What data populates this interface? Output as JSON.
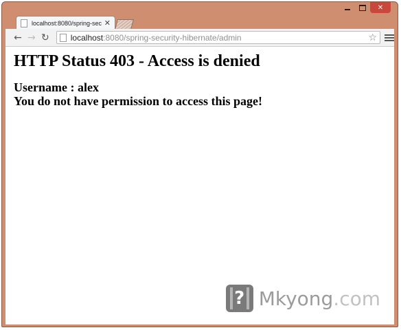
{
  "browser": {
    "tab": {
      "title": "localhost:8080/spring-sec",
      "close_glyph": "✕"
    },
    "address": {
      "host": "localhost",
      "rest": ":8080/spring-security-hibernate/admin"
    },
    "icons": {
      "back": "back-arrow-icon",
      "forward": "forward-arrow-icon",
      "reload": "reload-icon",
      "bookmark": "star-icon",
      "menu": "hamburger-menu-icon"
    }
  },
  "page": {
    "heading": "HTTP Status 403 - Access is denied",
    "username_line": "Username : alex",
    "message": "You do not have permission to access this page!"
  },
  "watermark": {
    "name": "Mkyong",
    "suffix": ".com"
  },
  "colors": {
    "window_frame": "#d08e70",
    "close_button": "#c8493b"
  }
}
